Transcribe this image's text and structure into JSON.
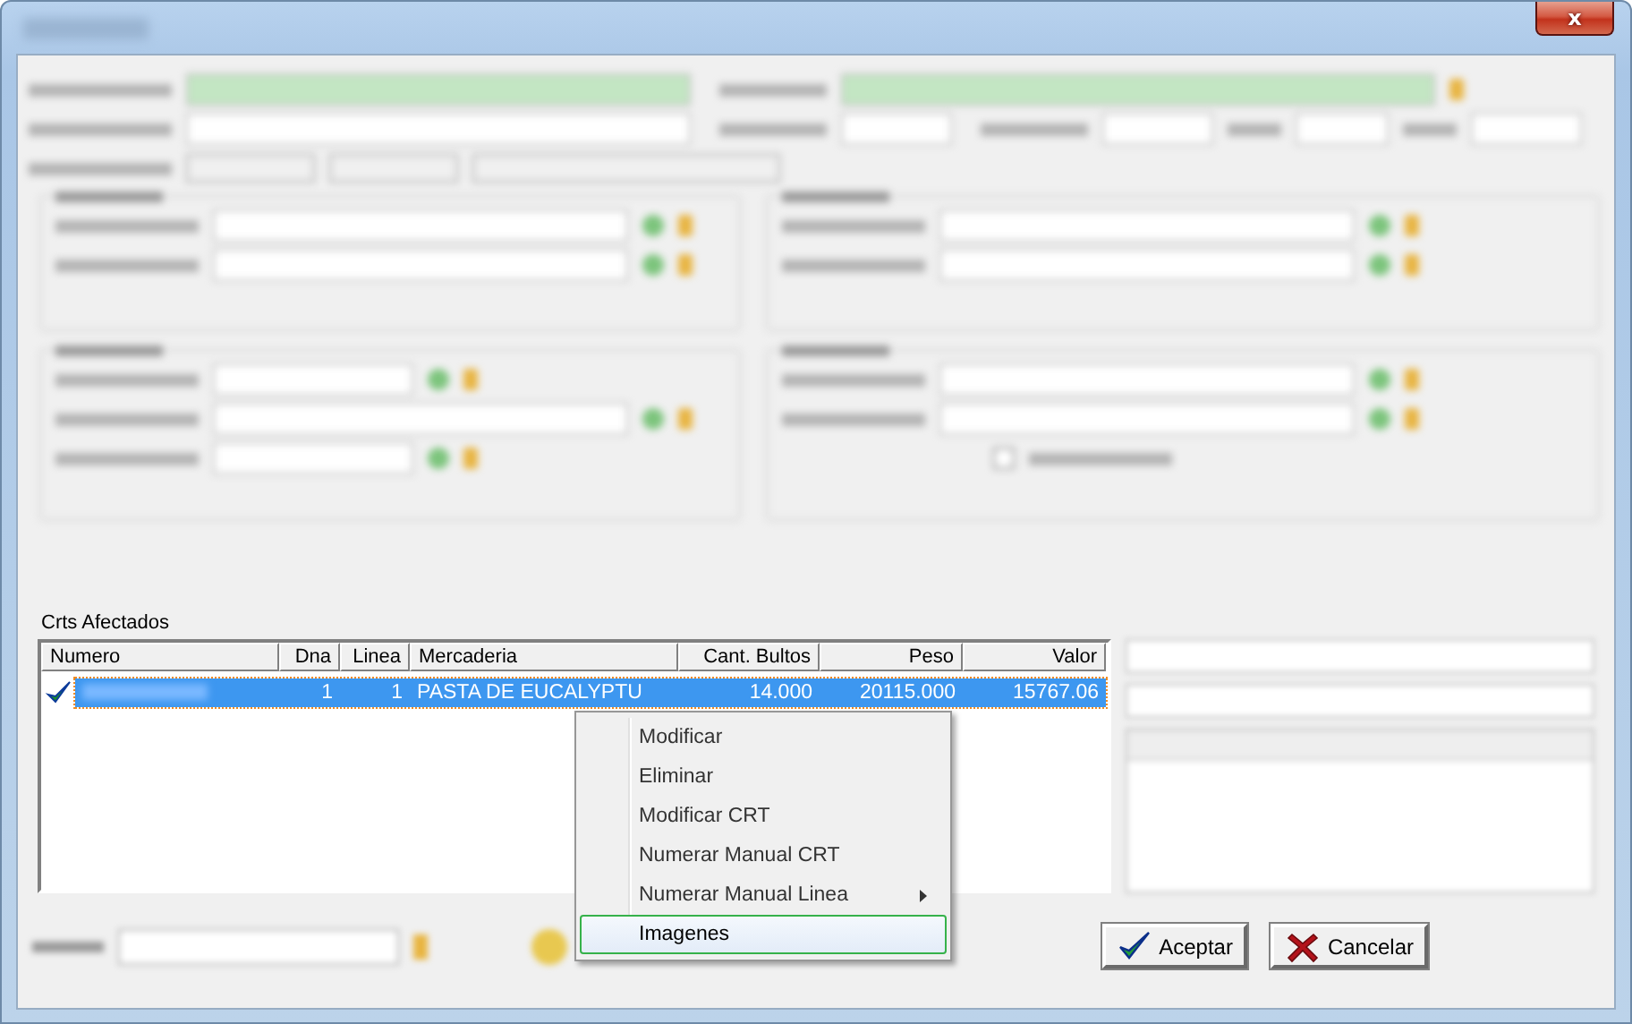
{
  "window": {
    "close_label": "x"
  },
  "grid": {
    "title": "Crts Afectados",
    "columns": [
      {
        "label": "Numero",
        "kind": "text"
      },
      {
        "label": "Dna",
        "kind": "number"
      },
      {
        "label": "Linea",
        "kind": "number"
      },
      {
        "label": "Mercaderia",
        "kind": "text"
      },
      {
        "label": "Cant. Bultos",
        "kind": "number"
      },
      {
        "label": "Peso",
        "kind": "number"
      },
      {
        "label": "Valor",
        "kind": "number"
      }
    ],
    "rows": [
      {
        "selected": true,
        "checked": true,
        "cells": [
          "",
          "1",
          "1",
          "PASTA  DE EUCALYPTU",
          "14.000",
          "20115.000",
          "15767.06"
        ]
      }
    ]
  },
  "context_menu": {
    "items": [
      {
        "label": "Modificar",
        "submenu": false,
        "selected": false
      },
      {
        "label": "Eliminar",
        "submenu": false,
        "selected": false
      },
      {
        "label": "Modificar CRT",
        "submenu": false,
        "selected": false
      },
      {
        "label": "Numerar Manual CRT",
        "submenu": false,
        "selected": false
      },
      {
        "label": "Numerar Manual Linea",
        "submenu": true,
        "selected": false
      },
      {
        "label": "Imagenes",
        "submenu": false,
        "selected": true
      }
    ]
  },
  "buttons": [
    {
      "label": "Aceptar",
      "kind": "ok"
    },
    {
      "label": "Cancelar",
      "kind": "cancel"
    }
  ]
}
